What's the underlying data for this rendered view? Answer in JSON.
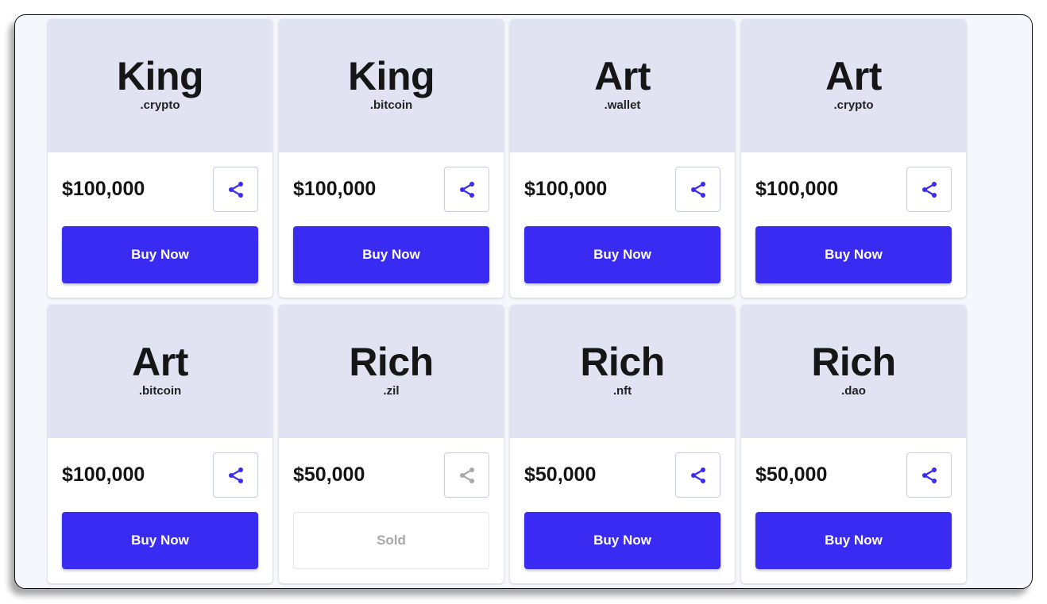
{
  "colors": {
    "accent": "#3a2bf2",
    "card_header": "#e1e3f2",
    "page_bg": "#f6f7fd",
    "disabled": "#a8a8ad"
  },
  "cards": [
    {
      "name": "King",
      "tld": ".crypto",
      "price": "$100,000",
      "action": "Buy Now",
      "sold": false,
      "share_icon": "share-icon"
    },
    {
      "name": "King",
      "tld": ".bitcoin",
      "price": "$100,000",
      "action": "Buy Now",
      "sold": false,
      "share_icon": "share-icon"
    },
    {
      "name": "Art",
      "tld": ".wallet",
      "price": "$100,000",
      "action": "Buy Now",
      "sold": false,
      "share_icon": "share-icon"
    },
    {
      "name": "Art",
      "tld": ".crypto",
      "price": "$100,000",
      "action": "Buy Now",
      "sold": false,
      "share_icon": "share-icon"
    },
    {
      "name": "Art",
      "tld": ".bitcoin",
      "price": "$100,000",
      "action": "Buy Now",
      "sold": false,
      "share_icon": "share-icon"
    },
    {
      "name": "Rich",
      "tld": ".zil",
      "price": "$50,000",
      "action": "Sold",
      "sold": true,
      "share_icon": "share-icon"
    },
    {
      "name": "Rich",
      "tld": ".nft",
      "price": "$50,000",
      "action": "Buy Now",
      "sold": false,
      "share_icon": "share-icon"
    },
    {
      "name": "Rich",
      "tld": ".dao",
      "price": "$50,000",
      "action": "Buy Now",
      "sold": false,
      "share_icon": "share-icon"
    }
  ]
}
